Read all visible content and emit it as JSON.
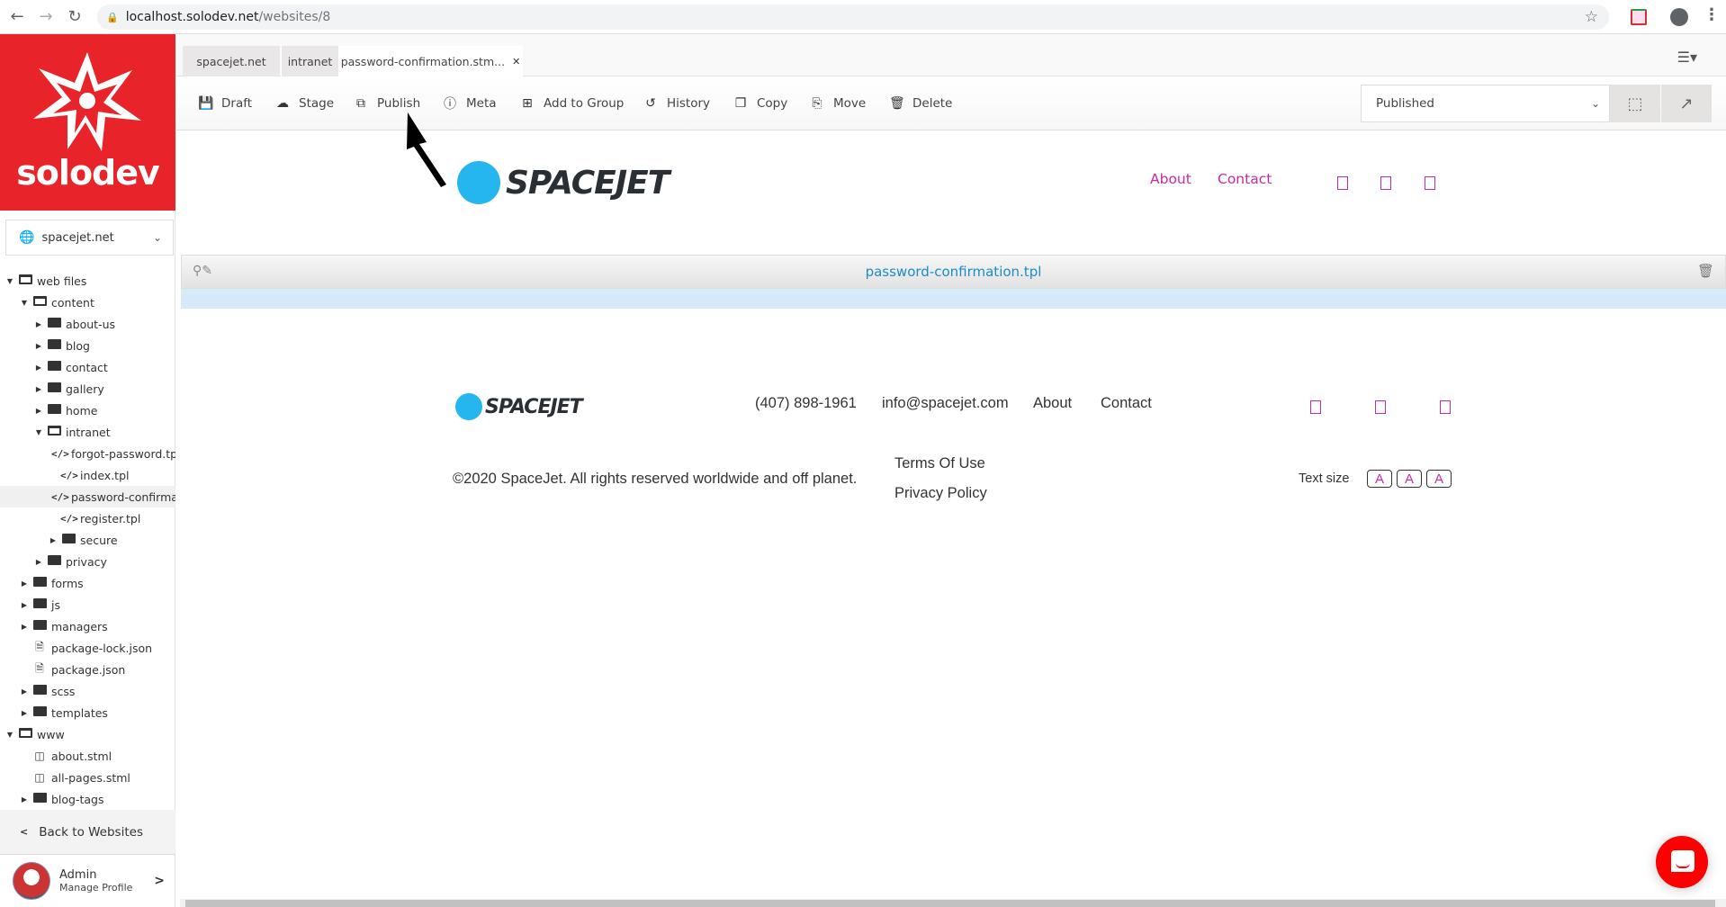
{
  "browser": {
    "url_host": "localhost.solodev.net",
    "url_path": "/websites/8",
    "back_icon": "arrow-left",
    "forward_icon": "arrow-right",
    "reload_icon": "reload"
  },
  "sidebar": {
    "brand": "solodev",
    "site_select": "spacejet.net",
    "tree": [
      {
        "label": "web files",
        "type": "folder-open",
        "level": 0,
        "caret": "down"
      },
      {
        "label": "content",
        "type": "folder-open",
        "level": 1,
        "caret": "down"
      },
      {
        "label": "about-us",
        "type": "folder",
        "level": 2,
        "caret": "right"
      },
      {
        "label": "blog",
        "type": "folder",
        "level": 2,
        "caret": "right"
      },
      {
        "label": "contact",
        "type": "folder",
        "level": 2,
        "caret": "right"
      },
      {
        "label": "gallery",
        "type": "folder",
        "level": 2,
        "caret": "right"
      },
      {
        "label": "home",
        "type": "folder",
        "level": 2,
        "caret": "right"
      },
      {
        "label": "intranet",
        "type": "folder-open",
        "level": 2,
        "caret": "down"
      },
      {
        "label": "forgot-password.tpl",
        "type": "code",
        "level": 3,
        "caret": ""
      },
      {
        "label": "index.tpl",
        "type": "code",
        "level": 3,
        "caret": ""
      },
      {
        "label": "password-confirmation.tpl",
        "type": "code",
        "level": 3,
        "caret": "",
        "selected": true
      },
      {
        "label": "register.tpl",
        "type": "code",
        "level": 3,
        "caret": ""
      },
      {
        "label": "secure",
        "type": "folder",
        "level": 3,
        "caret": "right"
      },
      {
        "label": "privacy",
        "type": "folder",
        "level": 2,
        "caret": "right"
      },
      {
        "label": "forms",
        "type": "folder",
        "level": 1,
        "caret": "right"
      },
      {
        "label": "js",
        "type": "folder",
        "level": 1,
        "caret": "right"
      },
      {
        "label": "managers",
        "type": "folder",
        "level": 1,
        "caret": "right"
      },
      {
        "label": "package-lock.json",
        "type": "file",
        "level": 1,
        "caret": ""
      },
      {
        "label": "package.json",
        "type": "file",
        "level": 1,
        "caret": ""
      },
      {
        "label": "scss",
        "type": "folder",
        "level": 1,
        "caret": "right"
      },
      {
        "label": "templates",
        "type": "folder",
        "level": 1,
        "caret": "right"
      },
      {
        "label": "www",
        "type": "folder-open",
        "level": 0,
        "caret": "down"
      },
      {
        "label": "about.stml",
        "type": "page",
        "level": 1,
        "caret": ""
      },
      {
        "label": "all-pages.stml",
        "type": "page",
        "level": 1,
        "caret": ""
      },
      {
        "label": "blog-tags",
        "type": "folder",
        "level": 1,
        "caret": "right"
      }
    ],
    "back_label": "Back to Websites",
    "profile": {
      "name": "Admin",
      "sub": "Manage Profile"
    }
  },
  "tabs": [
    {
      "label": "spacejet.net"
    },
    {
      "label": "intranet"
    },
    {
      "label": "password-confirmation.stm...",
      "active": true,
      "closable": true
    }
  ],
  "toolbar": {
    "buttons": [
      {
        "label": "Draft",
        "icon": "save-icon"
      },
      {
        "label": "Stage",
        "icon": "cloud-upload-icon"
      },
      {
        "label": "Publish",
        "icon": "share-icon"
      },
      {
        "label": "Meta",
        "icon": "info-icon"
      },
      {
        "label": "Add to Group",
        "icon": "plus-square-icon"
      },
      {
        "label": "History",
        "icon": "history-icon"
      },
      {
        "label": "Copy",
        "icon": "copy-icon"
      },
      {
        "label": "Move",
        "icon": "move-icon"
      },
      {
        "label": "Delete",
        "icon": "trash-icon"
      }
    ],
    "status_value": "Published"
  },
  "preview": {
    "brand": "SPACEJET",
    "nav": [
      "About",
      "Contact"
    ],
    "editor_file": "password-confirmation.tpl",
    "footer": {
      "phone": "(407) 898-1961",
      "email": "info@spacejet.com",
      "links": [
        "About",
        "Contact"
      ],
      "copyright": "©2020 SpaceJet. All rights reserved worldwide and off planet.",
      "legal": [
        "Terms Of Use",
        "Privacy Policy"
      ],
      "text_size_label": "Text size",
      "text_size_buttons": [
        "A",
        "A",
        "A"
      ]
    }
  },
  "colors": {
    "brand_red": "#e8232a",
    "link_magenta": "#c62aa6",
    "editor_link": "#1a8cc9"
  }
}
